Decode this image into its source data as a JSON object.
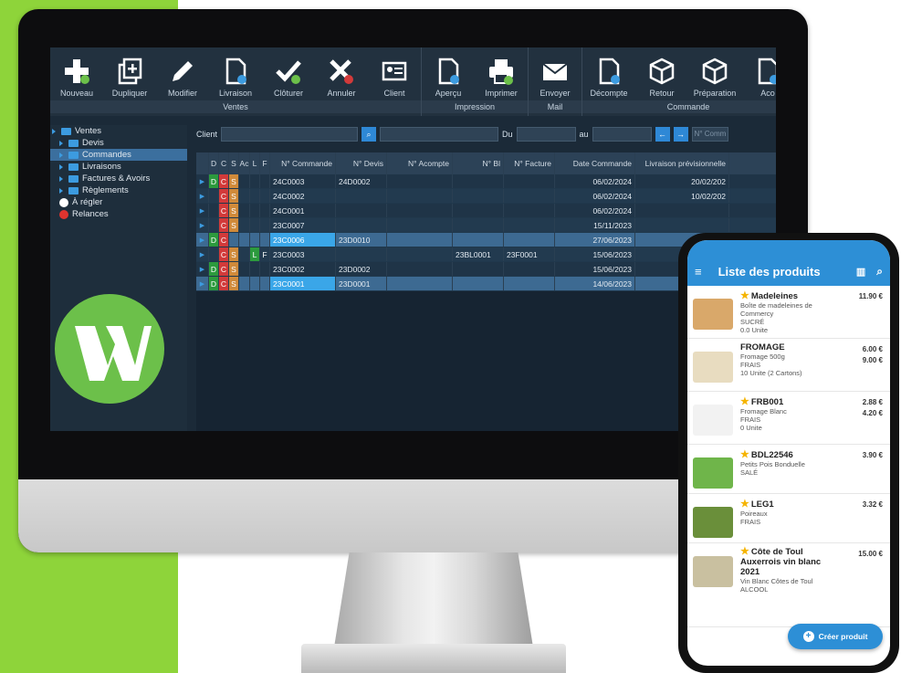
{
  "toolbar": {
    "groups": [
      {
        "title": "Ventes",
        "buttons": [
          "Nouveau",
          "Dupliquer",
          "Modifier",
          "Livraison",
          "Clôturer",
          "Annuler",
          "Client"
        ]
      },
      {
        "title": "Impression",
        "buttons": [
          "Aperçu",
          "Imprimer"
        ]
      },
      {
        "title": "Mail",
        "buttons": [
          "Envoyer"
        ]
      },
      {
        "title": "Commande",
        "buttons": [
          "Décompte",
          "Retour",
          "Préparation",
          "Aco"
        ]
      }
    ]
  },
  "tree": {
    "items": [
      {
        "label": "Ventes",
        "level": 0
      },
      {
        "label": "Devis",
        "level": 1
      },
      {
        "label": "Commandes",
        "level": 1,
        "selected": true
      },
      {
        "label": "Livraisons",
        "level": 1
      },
      {
        "label": "Factures & Avoirs",
        "level": 1
      },
      {
        "label": "Règlements",
        "level": 1
      },
      {
        "label": "À régler",
        "level": 1,
        "dot": "#ffffff"
      },
      {
        "label": "Relances",
        "level": 1,
        "dot": "#e0342f"
      }
    ]
  },
  "filter": {
    "client_label": "Client",
    "du_label": "Du",
    "au_label": "au",
    "search_placeholder": "N° Comm"
  },
  "grid": {
    "columns": [
      "D",
      "C",
      "S",
      "Ac",
      "L",
      "F",
      "N° Commande",
      "N° Devis",
      "N° Acompte",
      "N° Bl",
      "N° Facture",
      "Date Commande",
      "Livraison prévisionnelle"
    ],
    "rows": [
      {
        "D": "D",
        "C": "C",
        "S": "S",
        "Ac": "",
        "L": "",
        "F": "",
        "commande": "24C0003",
        "devis": "24D0002",
        "acompte": "",
        "bl": "",
        "facture": "",
        "date": "06/02/2024",
        "livraison": "20/02/202"
      },
      {
        "D": "",
        "C": "C",
        "S": "S",
        "Ac": "",
        "L": "",
        "F": "",
        "commande": "24C0002",
        "devis": "",
        "acompte": "",
        "bl": "",
        "facture": "",
        "date": "06/02/2024",
        "livraison": "10/02/202"
      },
      {
        "D": "",
        "C": "C",
        "S": "S",
        "Ac": "",
        "L": "",
        "F": "",
        "commande": "24C0001",
        "devis": "",
        "acompte": "",
        "bl": "",
        "facture": "",
        "date": "06/02/2024",
        "livraison": ""
      },
      {
        "D": "",
        "C": "C",
        "S": "S",
        "Ac": "",
        "L": "",
        "F": "",
        "commande": "23C0007",
        "devis": "",
        "acompte": "",
        "bl": "",
        "facture": "",
        "date": "15/11/2023",
        "livraison": ""
      },
      {
        "D": "D",
        "C": "C",
        "S": "",
        "Ac": "",
        "L": "",
        "F": "",
        "commande": "23C0006",
        "devis": "23D0010",
        "acompte": "",
        "bl": "",
        "facture": "",
        "date": "27/06/2023",
        "livraison": ""
      },
      {
        "D": "",
        "C": "C",
        "S": "S",
        "Ac": "",
        "L": "L",
        "F": "F",
        "commande": "23C0003",
        "devis": "",
        "acompte": "",
        "bl": "23BL0001",
        "facture": "23F0001",
        "date": "15/06/2023",
        "livraison": ""
      },
      {
        "D": "D",
        "C": "C",
        "S": "S",
        "Ac": "",
        "L": "",
        "F": "",
        "commande": "23C0002",
        "devis": "23D0002",
        "acompte": "",
        "bl": "",
        "facture": "",
        "date": "15/06/2023",
        "livraison": ""
      },
      {
        "D": "D",
        "C": "C",
        "S": "S",
        "Ac": "",
        "L": "",
        "F": "",
        "commande": "23C0001",
        "devis": "23D0001",
        "acompte": "",
        "bl": "",
        "facture": "",
        "date": "14/06/2023",
        "livraison": ""
      }
    ]
  },
  "phone": {
    "title": "Liste des produits",
    "products": [
      {
        "name": "Madeleines",
        "star": true,
        "desc": "Boîte de madeleines de Commercy",
        "family": "SUCRÉ",
        "stock": "0.0 Unite",
        "prices": [
          "11.90 €"
        ]
      },
      {
        "name": "FROMAGE",
        "star": false,
        "desc": "Fromage 500g",
        "family": "FRAIS",
        "stock": "10 Unite (2 Cartons)",
        "prices": [
          "6.00 €",
          "9.00 €"
        ]
      },
      {
        "name": "FRB001",
        "star": true,
        "desc": "Fromage Blanc",
        "family": "FRAIS",
        "stock": "0 Unite",
        "prices": [
          "2.88 €",
          "4.20 €"
        ]
      },
      {
        "name": "BDL22546",
        "star": true,
        "desc": "Petits Pois Bonduelle",
        "family": "SALÉ",
        "stock": "",
        "prices": [
          "3.90 €"
        ]
      },
      {
        "name": "LEG1",
        "star": true,
        "desc": "Poireaux",
        "family": "FRAIS",
        "stock": "",
        "prices": [
          "3.32 €"
        ]
      },
      {
        "name": "Côte de Toul Auxerrois vin blanc 2021",
        "star": true,
        "desc": "Vin Blanc Côtes de Toul",
        "family": "ALCOOL",
        "stock": "",
        "prices": [
          "15.00 €"
        ]
      }
    ],
    "fab_label": "Créer produit"
  },
  "colors": {
    "brand_green": "#8ed43a",
    "accent_blue": "#2d8fd6",
    "flag_d": "#2c9a3d",
    "flag_c": "#d23a3a",
    "flag_s": "#d08a3a",
    "flag_l": "#2c9a3d"
  }
}
